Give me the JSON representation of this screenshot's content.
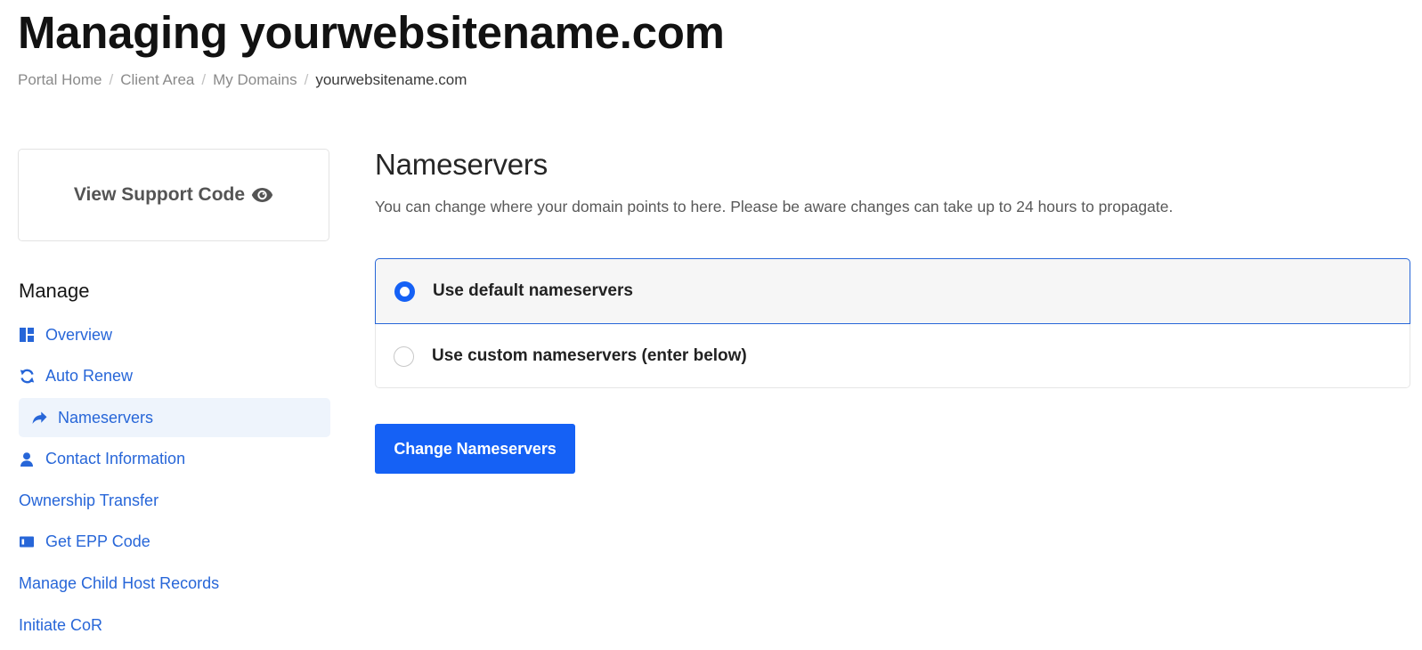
{
  "page": {
    "title": "Managing yourwebsitename.com"
  },
  "breadcrumb": [
    {
      "label": "Portal Home"
    },
    {
      "label": "Client Area"
    },
    {
      "label": "My Domains"
    },
    {
      "label": "yourwebsitename.com"
    }
  ],
  "breadcrumb_separator": "/",
  "support": {
    "label": "View Support Code",
    "icon": "eye-icon"
  },
  "sidebar": {
    "heading": "Manage",
    "items": [
      {
        "label": "Overview",
        "icon": "dashboard-icon"
      },
      {
        "label": "Auto Renew",
        "icon": "sync-icon"
      },
      {
        "label": "Nameservers",
        "icon": "share-arrow-icon",
        "active": true
      },
      {
        "label": "Contact Information",
        "icon": "user-icon"
      },
      {
        "label": "Ownership Transfer",
        "icon": ""
      },
      {
        "label": "Get EPP Code",
        "icon": "id-card-icon"
      },
      {
        "label": "Manage Child Host Records",
        "icon": ""
      },
      {
        "label": "Initiate CoR",
        "icon": ""
      }
    ]
  },
  "main": {
    "title": "Nameservers",
    "description": "You can change where your domain points to here. Please be aware changes can take up to 24 hours to propagate.",
    "options": [
      {
        "label": "Use default nameservers",
        "selected": true
      },
      {
        "label": "Use custom nameservers (enter below)",
        "selected": false
      }
    ],
    "submit_label": "Change Nameservers"
  },
  "colors": {
    "accent": "#1561f5",
    "link": "#2766d8",
    "active_bg": "#eef4fc"
  }
}
